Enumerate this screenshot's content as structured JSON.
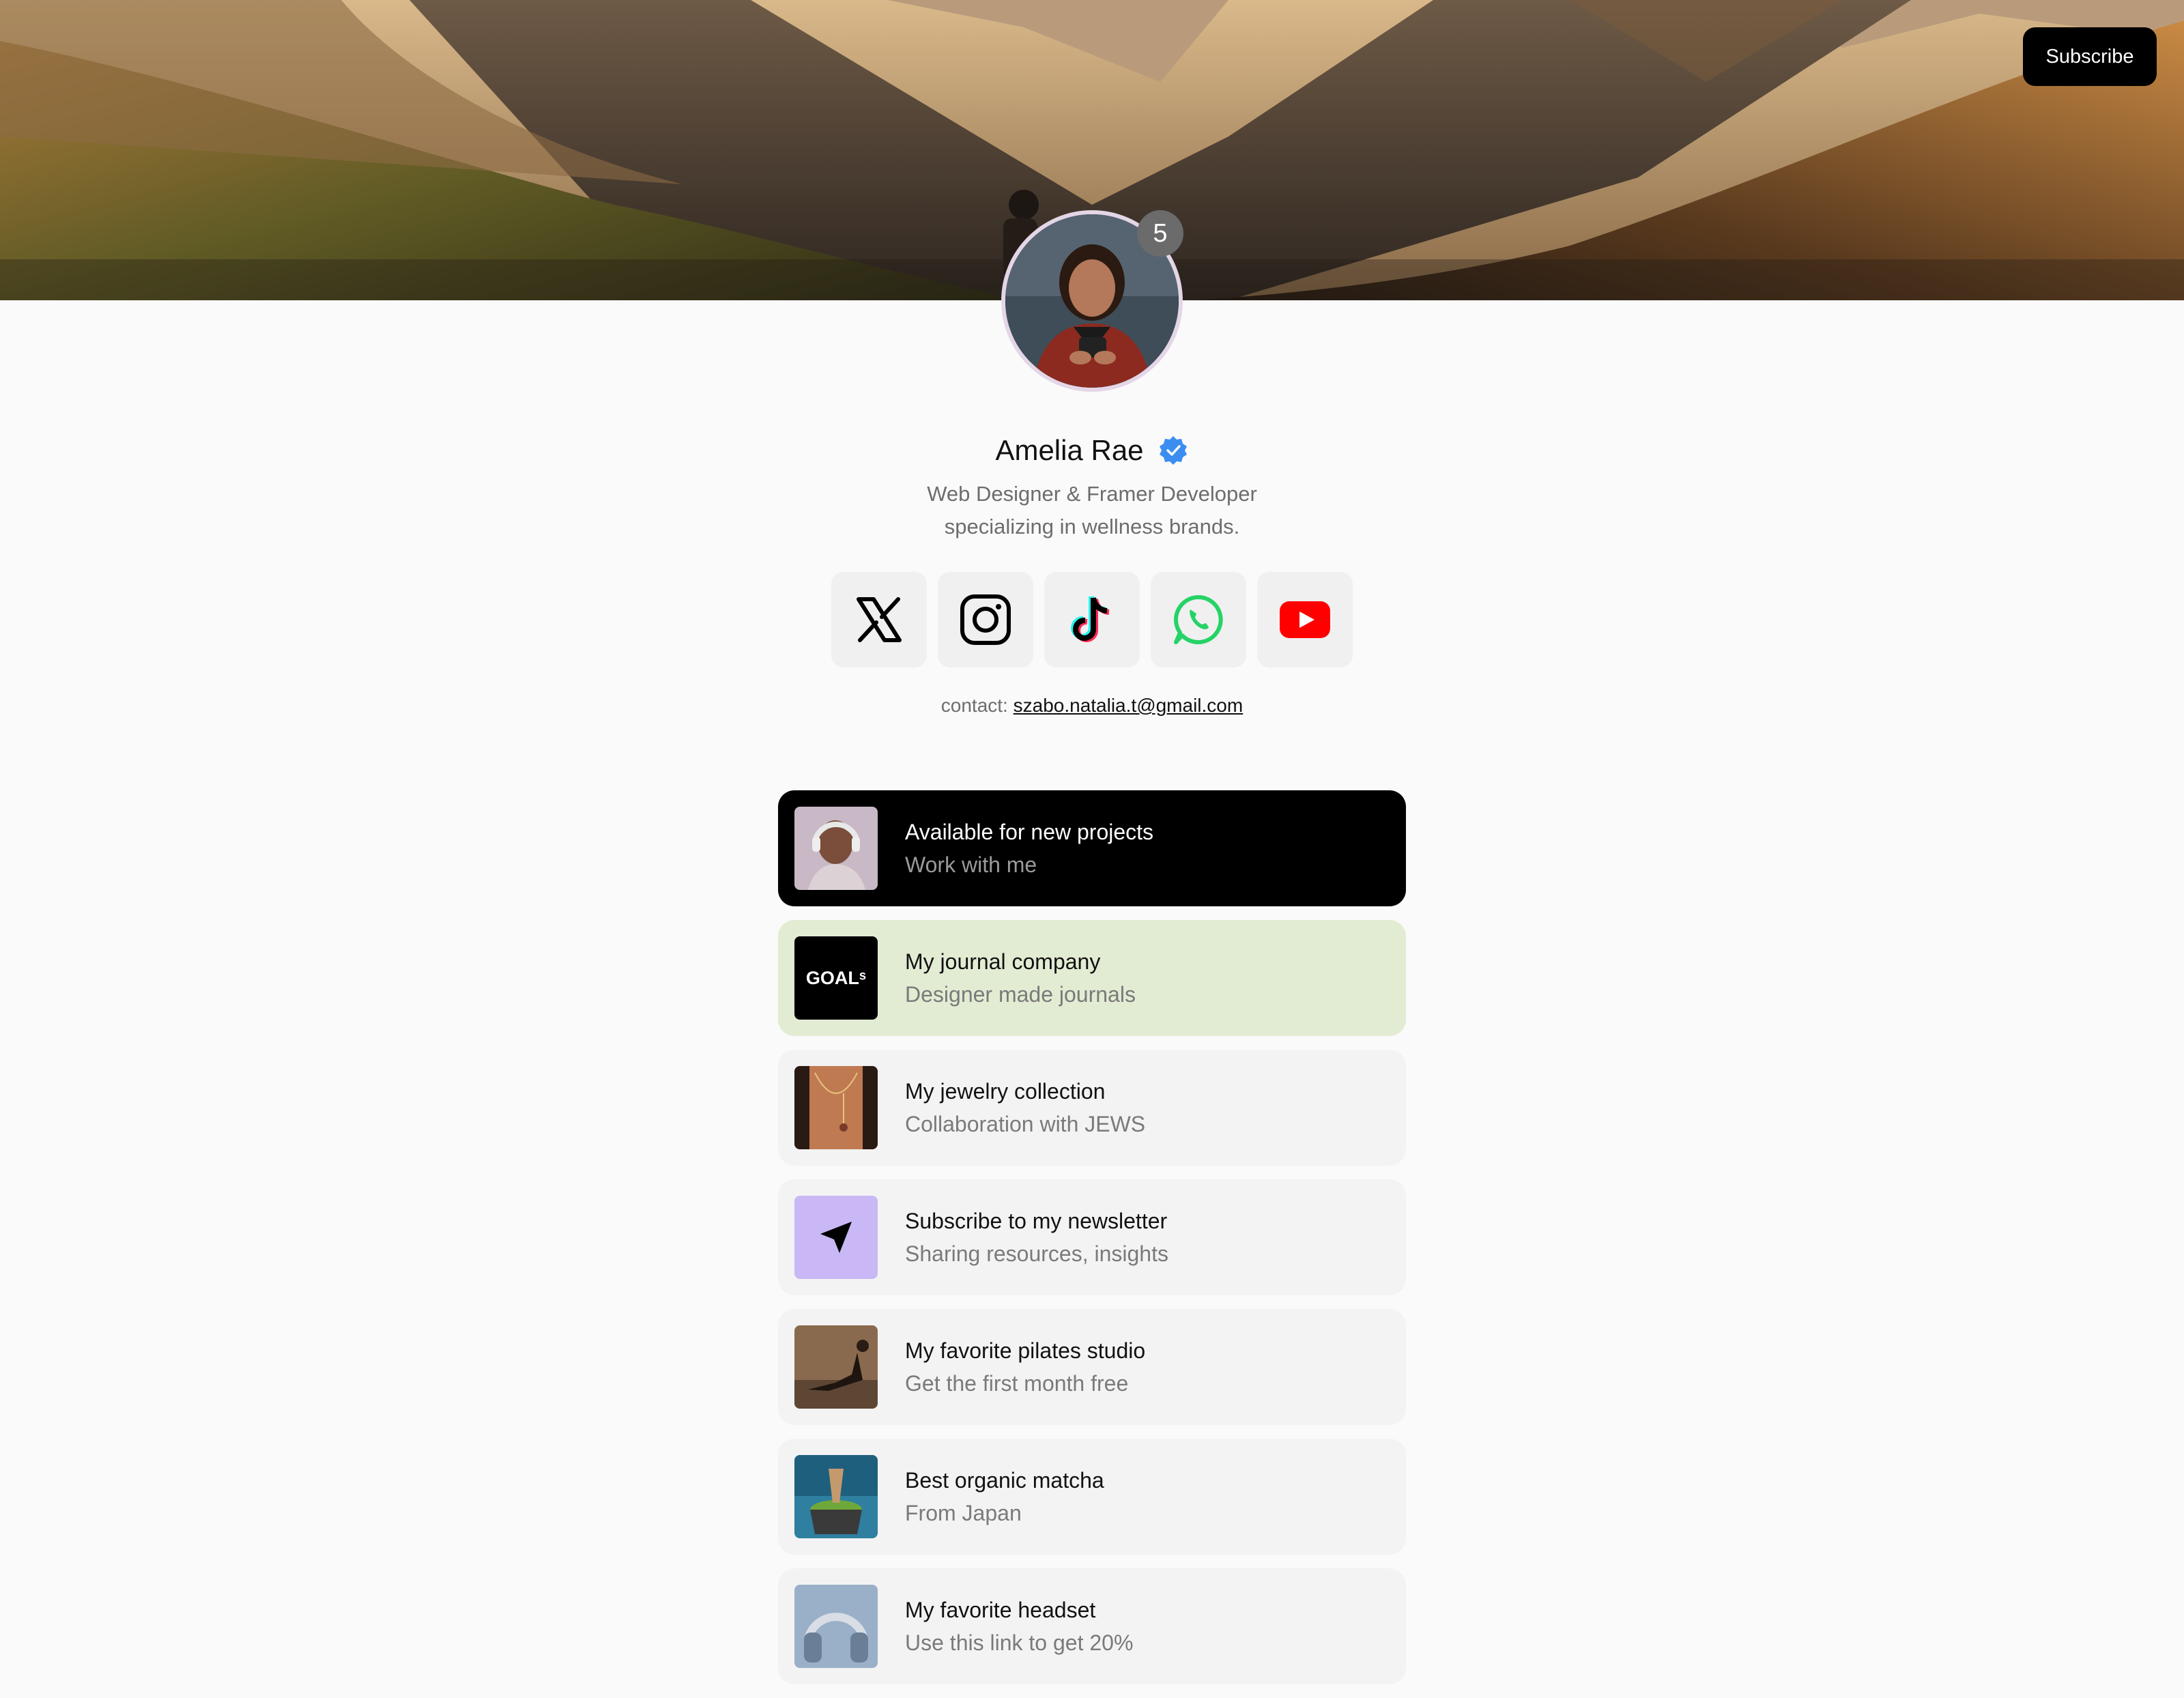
{
  "header": {
    "subscribe_label": "Subscribe"
  },
  "profile": {
    "notification_count": "5",
    "name": "Amelia Rae",
    "bio_line1": "Web Designer & Framer Developer",
    "bio_line2": "specializing in wellness brands.",
    "contact_label": "contact:",
    "contact_email": "szabo.natalia.t@gmail.com"
  },
  "socials": [
    {
      "icon": "x-icon"
    },
    {
      "icon": "instagram-icon"
    },
    {
      "icon": "tiktok-icon"
    },
    {
      "icon": "whatsapp-icon"
    },
    {
      "icon": "youtube-icon"
    }
  ],
  "links": [
    {
      "title": "Available for new projects",
      "subtitle": "Work with me"
    },
    {
      "title": "My journal company",
      "subtitle": "Designer made journals",
      "thumb_text": "GOALˢ"
    },
    {
      "title": "My jewelry collection",
      "subtitle": "Collaboration with JEWS"
    },
    {
      "title": "Subscribe to my newsletter",
      "subtitle": "Sharing resources, insights"
    },
    {
      "title": "My favorite pilates studio",
      "subtitle": "Get the first month free"
    },
    {
      "title": "Best organic matcha",
      "subtitle": "From Japan"
    },
    {
      "title": "My favorite headset",
      "subtitle": "Use this link to get 20%"
    }
  ],
  "colors": {
    "accent_dark": "#000000",
    "journal_card": "#e2ecd3",
    "newsletter_thumb": "#c9b8f5",
    "verified_blue": "#3b8ef0"
  }
}
